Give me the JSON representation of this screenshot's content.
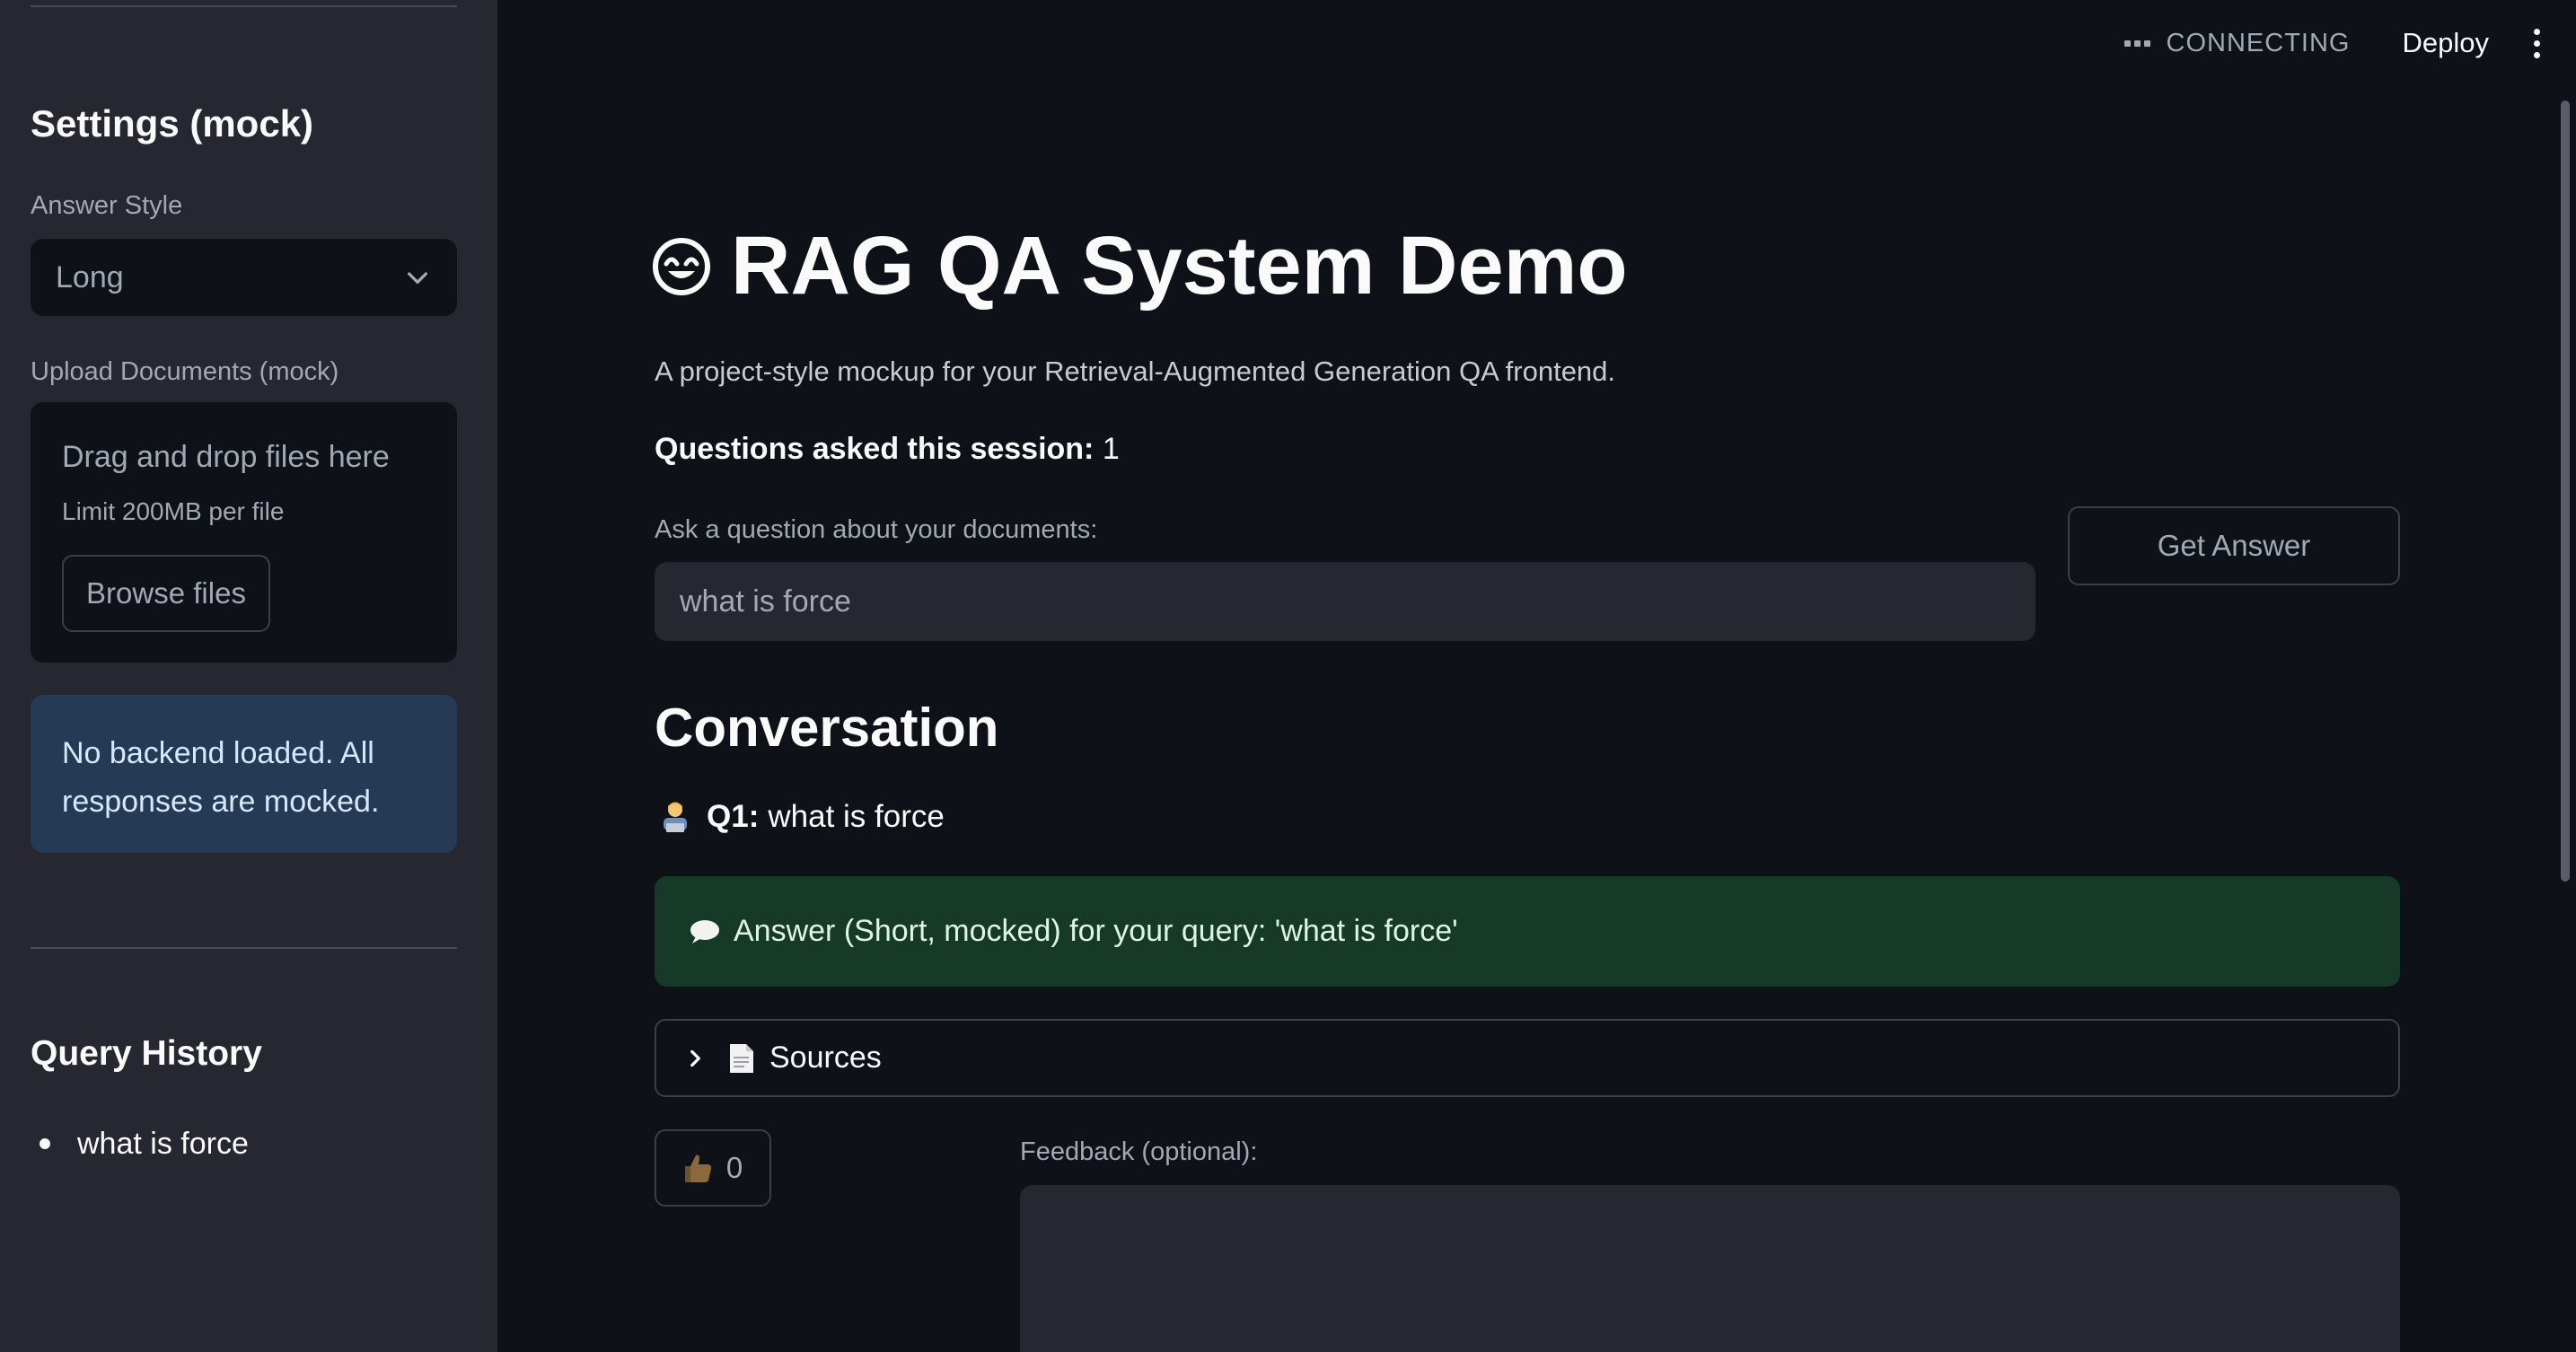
{
  "header": {
    "status_text": "CONNECTING",
    "deploy_label": "Deploy"
  },
  "sidebar": {
    "settings_title": "Settings (mock)",
    "answer_style": {
      "label": "Answer Style",
      "selected": "Long"
    },
    "upload": {
      "label": "Upload Documents (mock)",
      "dropzone_title": "Drag and drop files here",
      "limit_text": "Limit 200MB per file",
      "browse_label": "Browse files"
    },
    "info_message": "No backend loaded. All responses are mocked.",
    "history_title": "Query History",
    "history_items": [
      "what is force"
    ]
  },
  "main": {
    "title": "RAG QA System Demo",
    "subtitle": "A project-style mockup for your Retrieval-Augmented Generation QA frontend.",
    "counter_label": "Questions asked this session:",
    "counter_value": "1",
    "question": {
      "label": "Ask a question about your documents:",
      "value": "what is force"
    },
    "get_answer_label": "Get Answer",
    "conversation_title": "Conversation",
    "conversation": [
      {
        "q_label": "Q1:",
        "question": "what is force",
        "answer": "Answer (Short, mocked) for your query: 'what is force'",
        "sources_label": "Sources",
        "likes": "0",
        "feedback_label": "Feedback (optional):"
      }
    ]
  },
  "colors": {
    "background": "#0e1117",
    "sidebar": "#262730",
    "info_box": "#243a55",
    "success_box": "#173928"
  },
  "icons": [
    "robot-face-icon",
    "technologist-icon",
    "speech-bubble-icon",
    "document-icon",
    "thumbs-up-icon",
    "chevron-down-icon",
    "chevron-right-icon",
    "kebab-menu-icon"
  ]
}
